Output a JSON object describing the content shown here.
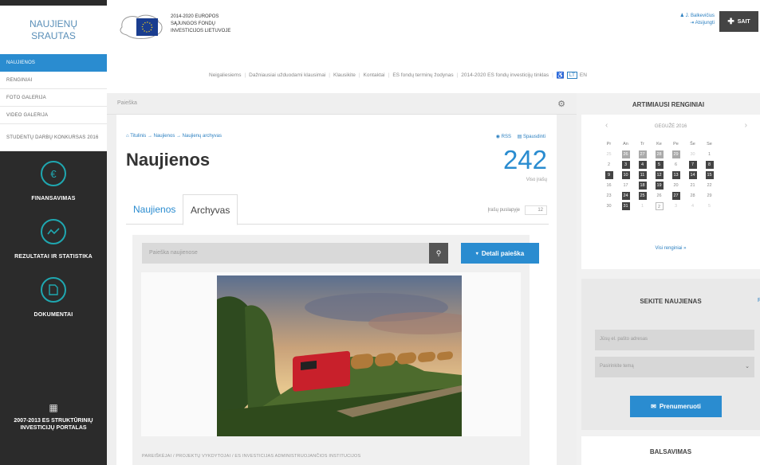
{
  "sidebar": {
    "logo": [
      "NAUJIENŲ",
      "SRAUTAS"
    ],
    "menu": [
      {
        "label": "NAUJIENOS",
        "active": true
      },
      {
        "label": "RENGINIAI",
        "active": false
      },
      {
        "label": "FOTO GALERIJA",
        "active": false
      },
      {
        "label": "VIDEO GALERIJA",
        "active": false
      },
      {
        "label": "STUDENTŲ DARBŲ KONKURSAS 2016",
        "active": false
      }
    ],
    "sections": [
      {
        "label": "FINANSAVIMAS",
        "icon": "euro-icon"
      },
      {
        "label": "REZULTATAI IR STATISTIKA",
        "icon": "chart-icon"
      },
      {
        "label": "DOKUMENTAI",
        "icon": "document-icon"
      }
    ],
    "bottom": {
      "label": "2007-2013 ES STRUKTŪRINIŲ INVESTICIJŲ PORTALAS",
      "icon": "calendar-icon"
    }
  },
  "header": {
    "eu_lines": [
      "2014-2020 EUROPOS",
      "SĄJUNGOS FONDŲ",
      "INVESTICIJOS LIETUVOJE"
    ],
    "user_name": "J. Balkevičius",
    "logout": "Atsijungti",
    "sait_button": "SAIT",
    "nav": [
      "Neigaliesiems",
      "Dažniausiai užduodami klausimai",
      "Klausikite",
      "Kontaktai",
      "ES fondų terminų žodynas",
      "2014-2020 ES fondų investicijų tinklas"
    ],
    "lang_lt": "LT",
    "lang_en": "EN"
  },
  "search_bar_label": "Paieška",
  "main": {
    "breadcrumb": "Titulinis → Naujienos → Naujienų archyvas",
    "rss": "RSS",
    "print": "Spausdinti",
    "title": "Naujienos",
    "count": "242",
    "count_label": "Viso įrašų",
    "tab_news": "Naujienos",
    "tab_archive": "Archyvas",
    "per_page_label": "Įrašų puslapyje",
    "per_page_value": "12",
    "search_placeholder": "Paieška naujienose",
    "detail_search": "Detali paieška",
    "caption": "PAREIŠKĖJAI / PROJEKTŲ VYKDYTOJAI / ES INVESTICIJAS ADMINISTRUOJANČIOS INSTITUCIJOS"
  },
  "right": {
    "events_title": "ARTIMIAUSI RENGINIAI",
    "calendar": {
      "month": "GEGUŽĖ 2016",
      "weekdays": [
        "Pr",
        "An",
        "Tr",
        "Ke",
        "Pe",
        "Še",
        "Se"
      ],
      "days": [
        {
          "d": "25",
          "s": "mute"
        },
        {
          "d": "26",
          "s": "evl"
        },
        {
          "d": "27",
          "s": "evl"
        },
        {
          "d": "28",
          "s": "evl"
        },
        {
          "d": "29",
          "s": "evl"
        },
        {
          "d": "30",
          "s": "mute"
        },
        {
          "d": "1",
          "s": ""
        },
        {
          "d": "2",
          "s": ""
        },
        {
          "d": "3",
          "s": "ev"
        },
        {
          "d": "4",
          "s": "ev"
        },
        {
          "d": "5",
          "s": "ev"
        },
        {
          "d": "6",
          "s": ""
        },
        {
          "d": "7",
          "s": "ev"
        },
        {
          "d": "8",
          "s": "ev"
        },
        {
          "d": "9",
          "s": "ev"
        },
        {
          "d": "10",
          "s": "ev"
        },
        {
          "d": "11",
          "s": "ev"
        },
        {
          "d": "12",
          "s": "ev"
        },
        {
          "d": "13",
          "s": "ev"
        },
        {
          "d": "14",
          "s": "ev"
        },
        {
          "d": "15",
          "s": "ev"
        },
        {
          "d": "16",
          "s": ""
        },
        {
          "d": "17",
          "s": ""
        },
        {
          "d": "18",
          "s": "ev"
        },
        {
          "d": "19",
          "s": "ev"
        },
        {
          "d": "20",
          "s": ""
        },
        {
          "d": "21",
          "s": ""
        },
        {
          "d": "22",
          "s": ""
        },
        {
          "d": "23",
          "s": ""
        },
        {
          "d": "24",
          "s": "ev"
        },
        {
          "d": "25",
          "s": "ev"
        },
        {
          "d": "26",
          "s": ""
        },
        {
          "d": "27",
          "s": "ev"
        },
        {
          "d": "28",
          "s": ""
        },
        {
          "d": "29",
          "s": ""
        },
        {
          "d": "30",
          "s": ""
        },
        {
          "d": "31",
          "s": "ev"
        },
        {
          "d": "1",
          "s": "mute"
        },
        {
          "d": "2",
          "s": "today"
        },
        {
          "d": "3",
          "s": "mute"
        },
        {
          "d": "4",
          "s": "mute"
        },
        {
          "d": "5",
          "s": "mute"
        }
      ]
    },
    "all_events": "Visi renginiai »",
    "follow_title": "SEKITE NAUJIENAS",
    "follow_rss": "R",
    "email_placeholder": "Jūsų el. pašto adresas",
    "topic_placeholder": "Pasirinkite temą",
    "subscribe": "Prenumeruoti",
    "vote_title": "BALSAVIMAS"
  },
  "colors": {
    "accent": "#2a8cd0",
    "sidebar": "#2b2b2b",
    "teal": "#1fa7b0"
  }
}
